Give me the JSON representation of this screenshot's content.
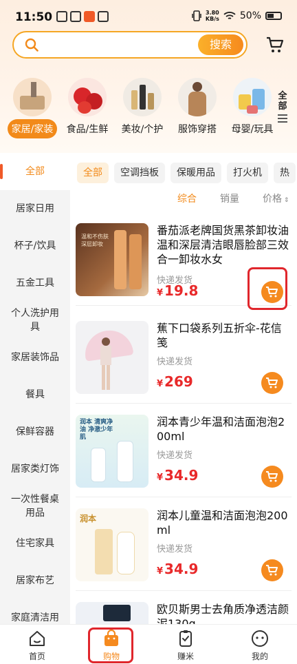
{
  "status": {
    "time": "11:50",
    "net_speed": "3.80",
    "net_unit": "KB/s",
    "battery": "50%"
  },
  "search": {
    "placeholder": "",
    "button": "搜索"
  },
  "categories": [
    {
      "label": "家居/家装",
      "icon": "home-goods-icon"
    },
    {
      "label": "食品/生鲜",
      "icon": "fresh-food-icon"
    },
    {
      "label": "美妆/个护",
      "icon": "cosmetics-icon"
    },
    {
      "label": "服饰穿搭",
      "icon": "apparel-icon"
    },
    {
      "label": "母婴/玩具",
      "icon": "baby-toys-icon"
    }
  ],
  "all_categories": "全部",
  "sidebar": [
    "全部",
    "居家日用",
    "杯子/饮具",
    "五金工具",
    "个人洗护用具",
    "家居装饰品",
    "餐具",
    "保鲜容器",
    "居家类灯饰",
    "一次性餐桌用品",
    "住宅家具",
    "居家布艺",
    "家庭清洁用"
  ],
  "chips": [
    "全部",
    "空调挡板",
    "保暖用品",
    "打火机",
    "热"
  ],
  "sort": {
    "comprehensive": "综合",
    "sales": "销量",
    "price": "价格"
  },
  "products": [
    {
      "name": "番茄派老牌国货黑茶卸妆油温和深层清洁眼唇脸部三效合一卸妆水女",
      "ship": "快递发货",
      "currency": "¥",
      "price": "19.8",
      "img_text": "温和不伤肤 深层卸妆"
    },
    {
      "name": "蕉下口袋系列五折伞-花信笺",
      "ship": "快递发货",
      "currency": "¥",
      "price": "269",
      "img_text": ""
    },
    {
      "name": "润本青少年温和洁面泡泡200ml",
      "ship": "快递发货",
      "currency": "¥",
      "price": "34.9",
      "img_text": "润本 清爽净油 净澈少年肌"
    },
    {
      "name": "润本儿童温和洁面泡泡200ml",
      "ship": "快递发货",
      "currency": "¥",
      "price": "34.9",
      "img_text": "润本"
    },
    {
      "name": "欧贝斯男士去角质净透洁颜泥130g",
      "ship": "",
      "currency": "",
      "price": "",
      "img_text": ""
    }
  ],
  "tabs": [
    {
      "label": "首页",
      "icon": "home-icon"
    },
    {
      "label": "购物",
      "icon": "shopping-bag-icon"
    },
    {
      "label": "赚米",
      "icon": "earn-icon"
    },
    {
      "label": "我的",
      "icon": "profile-icon"
    }
  ],
  "colors": {
    "accent": "#f58a1f",
    "price": "#e8292a",
    "highlight": "#e0262c"
  }
}
